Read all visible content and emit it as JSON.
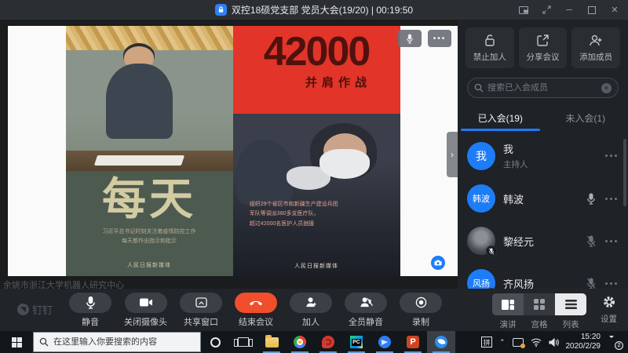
{
  "colors": {
    "accent": "#1d7df8",
    "danger": "#f14e2c",
    "poster_red": "#e23428",
    "poster_green": "#4d5a50"
  },
  "title_bar": {
    "title": "双控18硕党支部 党员大会(19/20) | 00:19:50"
  },
  "video": {
    "watermark": "余姚市浙江大学机器人研究中心",
    "more_dots": "•••",
    "chevron": "›",
    "left_poster": {
      "headline": "每天",
      "line1": "习近平总书记时刻关注着疫情防控工作",
      "line2": "每天都作出指示和批示",
      "credit": "人民日报新媒体"
    },
    "right_poster": {
      "headline": "42000",
      "subheadline": "并肩作战",
      "line1": "组织29个省区市和新疆生产建设兵团",
      "line2": "军队等调派380多支医疗队，",
      "line3": "超过42000名医护人员驰援",
      "credit": "人民日报新媒体"
    }
  },
  "sidebar": {
    "actions": [
      {
        "label": "禁止加人",
        "icon": "unlock-icon"
      },
      {
        "label": "分享会议",
        "icon": "share-icon"
      },
      {
        "label": "添加成员",
        "icon": "add-person-icon"
      }
    ],
    "search_placeholder": "搜索已入会成员",
    "tabs": [
      {
        "label": "已入会(19)",
        "active": true
      },
      {
        "label": "未入会(1)",
        "active": false
      }
    ],
    "members": [
      {
        "name": "我",
        "avatar": "我",
        "role": "主持人",
        "mic": "none"
      },
      {
        "name": "韩波",
        "avatar": "韩波",
        "mic": "on"
      },
      {
        "name": "黎经元",
        "avatar": "photo",
        "mic": "muted"
      },
      {
        "name": "齐风扬",
        "avatar": "风扬",
        "mic": "muted"
      }
    ]
  },
  "toolbar": {
    "brand": "钉钉",
    "buttons": [
      {
        "label": "静音",
        "icon": "mic-icon"
      },
      {
        "label": "关闭摄像头",
        "icon": "camera-icon"
      },
      {
        "label": "共享窗口",
        "icon": "share-window-icon"
      },
      {
        "label": "结束会议",
        "icon": "hangup-icon",
        "danger": true
      },
      {
        "label": "加人",
        "icon": "add-person-icon"
      },
      {
        "label": "全员静音",
        "icon": "mute-all-icon"
      },
      {
        "label": "录制",
        "icon": "record-icon"
      }
    ],
    "views": [
      {
        "label": "演讲",
        "active": false
      },
      {
        "label": "宫格",
        "active": false
      },
      {
        "label": "列表",
        "active": true
      }
    ],
    "settings": "设置"
  },
  "taskbar": {
    "search_placeholder": "在这里输入你要搜索的内容",
    "ime": "拼",
    "time": "15:20",
    "date": "2020/2/29",
    "badge": "2"
  }
}
